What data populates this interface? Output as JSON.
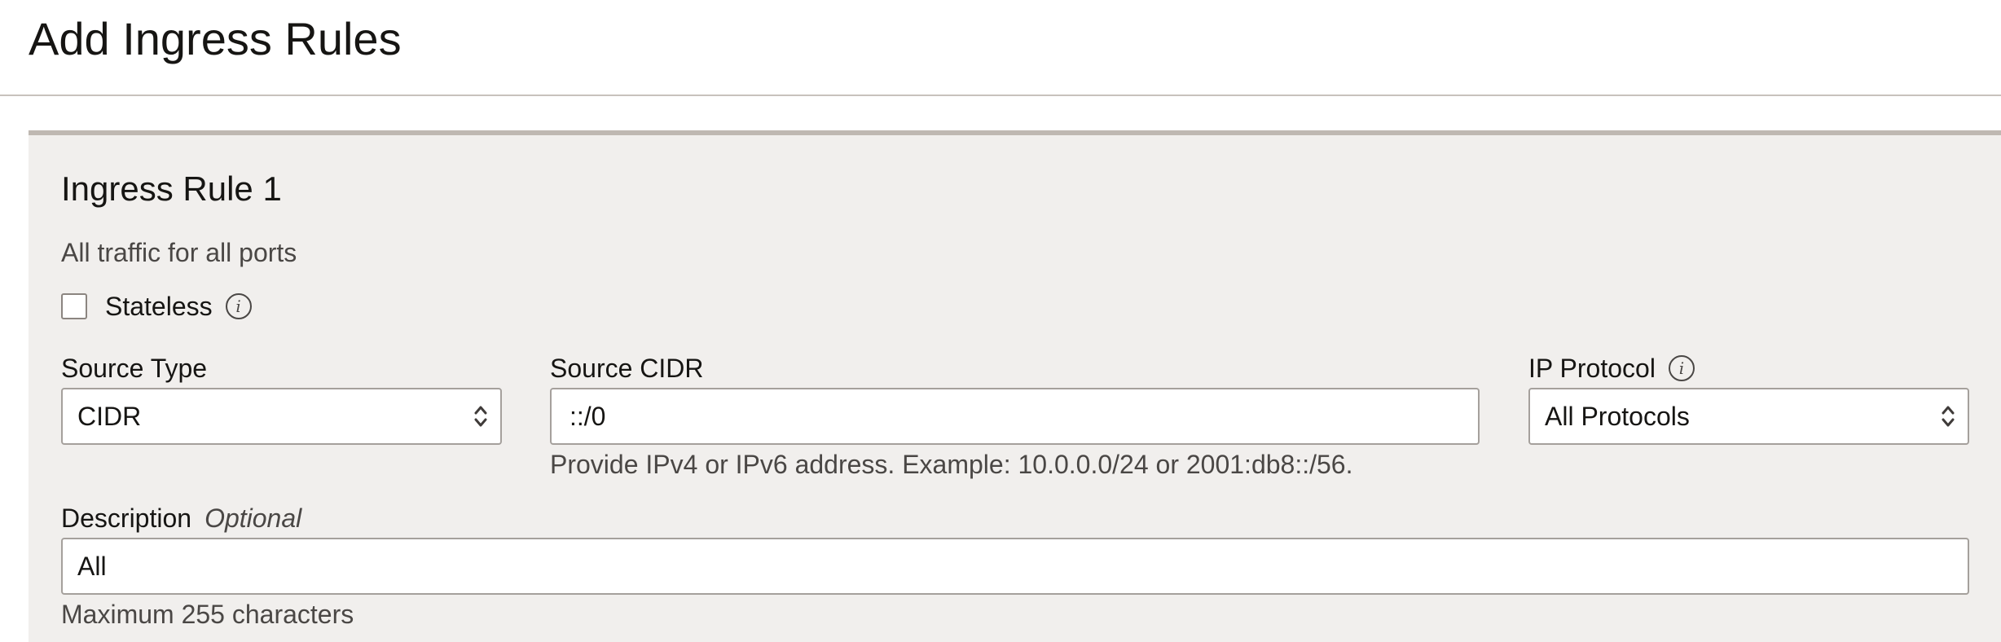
{
  "page": {
    "title": "Add Ingress Rules"
  },
  "rule": {
    "title": "Ingress Rule 1",
    "summary": "All traffic for all ports",
    "stateless": {
      "label": "Stateless",
      "checked": false
    },
    "source_type": {
      "label": "Source Type",
      "value": "CIDR"
    },
    "source_cidr": {
      "label": "Source CIDR",
      "value": "::/0",
      "help": "Provide IPv4 or IPv6 address. Example: 10.0.0.0/24 or 2001:db8::/56."
    },
    "ip_protocol": {
      "label": "IP Protocol",
      "value": "All Protocols"
    },
    "description": {
      "label": "Description",
      "optional_label": "Optional",
      "value": "All",
      "help": "Maximum 255 characters"
    }
  },
  "colors": {
    "panel_background": "#f1efed",
    "panel_top_border": "#bfb8b2",
    "text": "#161513",
    "muted_text": "#4a4745",
    "field_border": "#a5a09c"
  },
  "icons": {
    "info": "info-icon",
    "select": "up-down-chevron-icon"
  }
}
